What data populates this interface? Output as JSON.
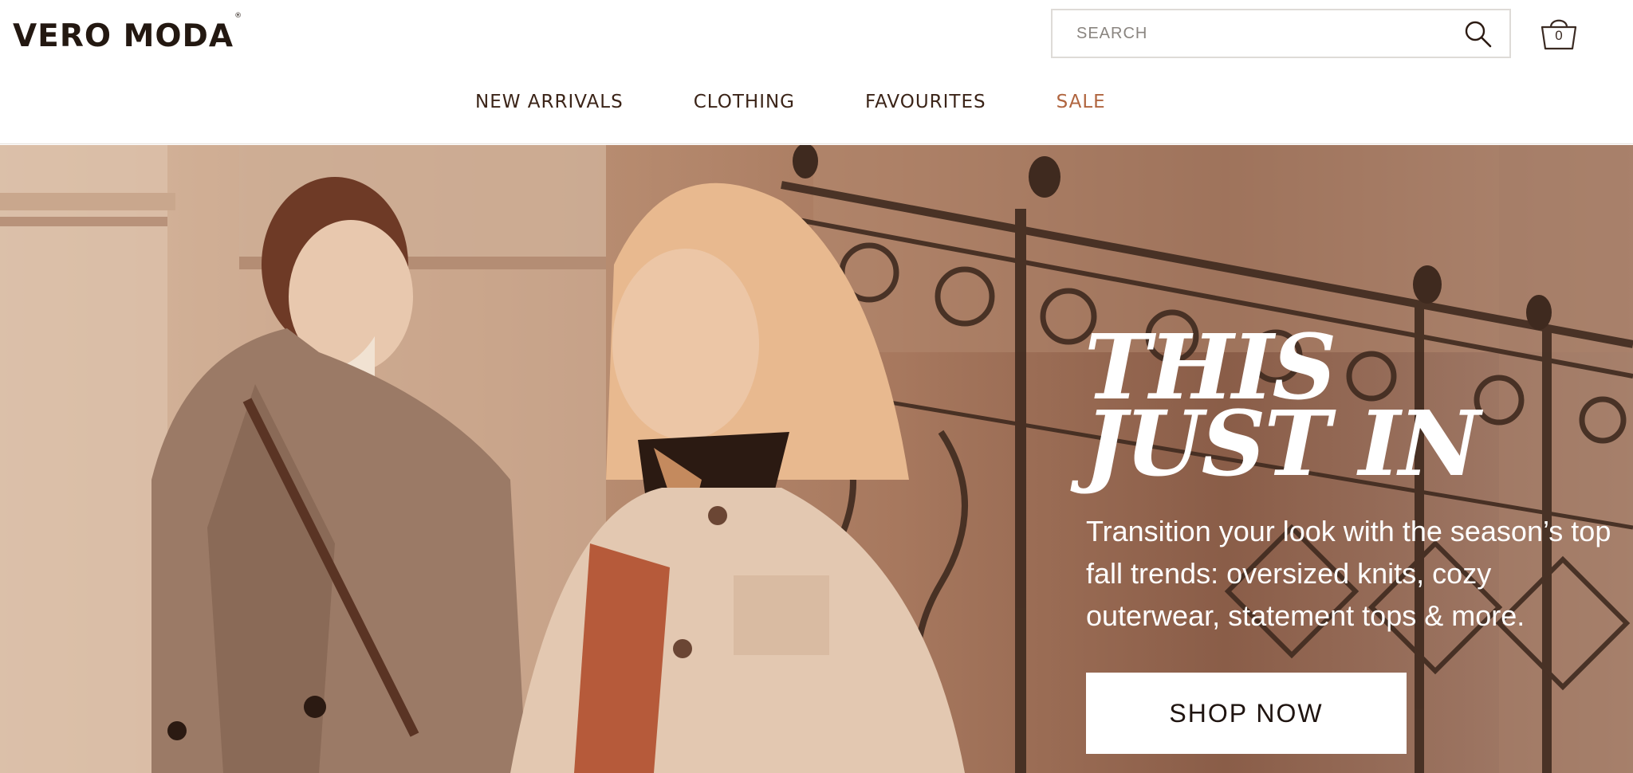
{
  "brand": {
    "logo_text": "VERO MODA",
    "logo_mark": "®"
  },
  "search": {
    "placeholder": "SEARCH",
    "icon": "search-icon"
  },
  "cart": {
    "count": "0",
    "icon": "shopping-bag-icon"
  },
  "nav": {
    "items": [
      {
        "label": "NEW ARRIVALS"
      },
      {
        "label": "CLOTHING"
      },
      {
        "label": "FAVOURITES"
      },
      {
        "label": "SALE",
        "color": "#b0653f"
      }
    ]
  },
  "hero": {
    "headline_line1": "THIS",
    "headline_line2": "JUST IN",
    "subtext": "Transition your look with the season’s top fall trends: oversized knits, cozy outerwear, statement tops & more.",
    "cta_label": "SHOP NOW"
  },
  "colors": {
    "text": "#2b1a12",
    "accent_sale": "#b0653f",
    "hero_tone": "#a7785e",
    "white": "#ffffff"
  }
}
